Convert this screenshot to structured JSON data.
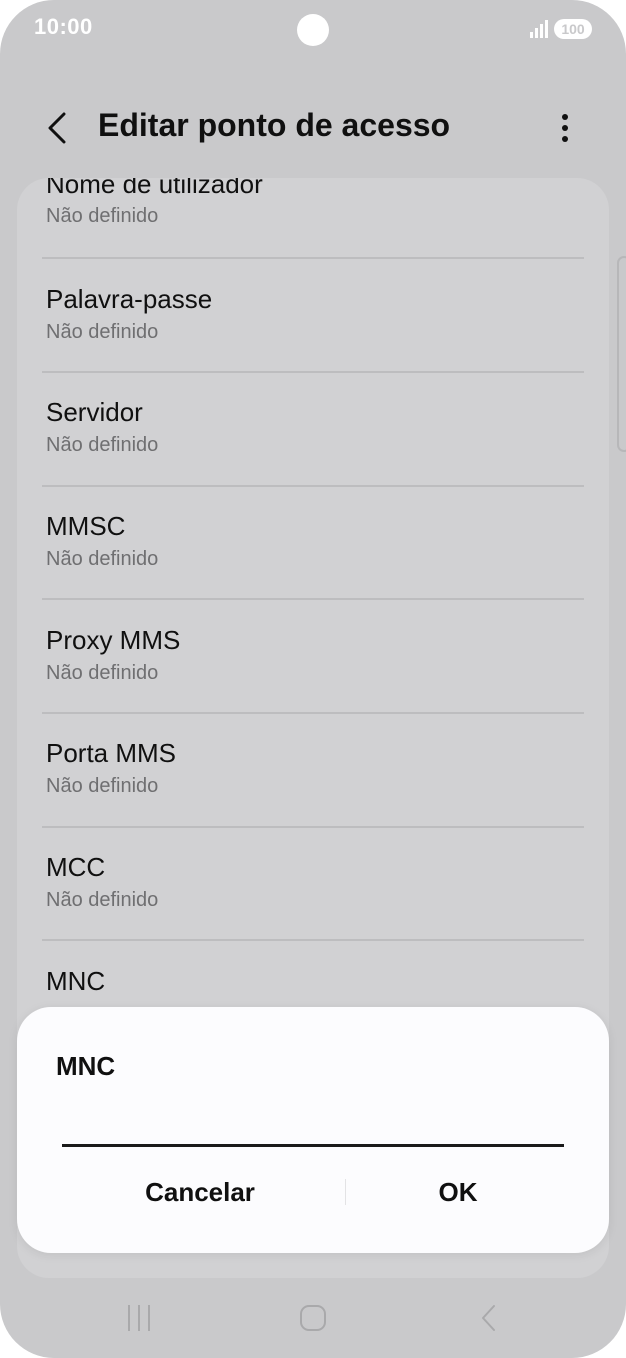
{
  "status_bar": {
    "time": "10:00",
    "battery": "100"
  },
  "header": {
    "title": "Editar ponto de acesso"
  },
  "list": {
    "items": [
      {
        "title": "Nome de utilizador",
        "value": "Não definido"
      },
      {
        "title": "Palavra-passe",
        "value": "Não definido"
      },
      {
        "title": "Servidor",
        "value": "Não definido"
      },
      {
        "title": "MMSC",
        "value": "Não definido"
      },
      {
        "title": "Proxy MMS",
        "value": "Não definido"
      },
      {
        "title": "Porta MMS",
        "value": "Não definido"
      },
      {
        "title": "MCC",
        "value": "Não definido"
      },
      {
        "title": "MNC",
        "value": ""
      }
    ]
  },
  "dialog": {
    "title": "MNC",
    "input_value": "",
    "cancel_label": "Cancelar",
    "ok_label": "OK"
  },
  "nav": {
    "icons": [
      "recent-apps-icon",
      "home-icon",
      "back-nav-icon"
    ]
  },
  "colors": {
    "background": "#c9c9cb",
    "card": "#d1d1d3",
    "dialog": "#fcfcfe",
    "text": "#101010",
    "subtext": "#6f6f71"
  }
}
